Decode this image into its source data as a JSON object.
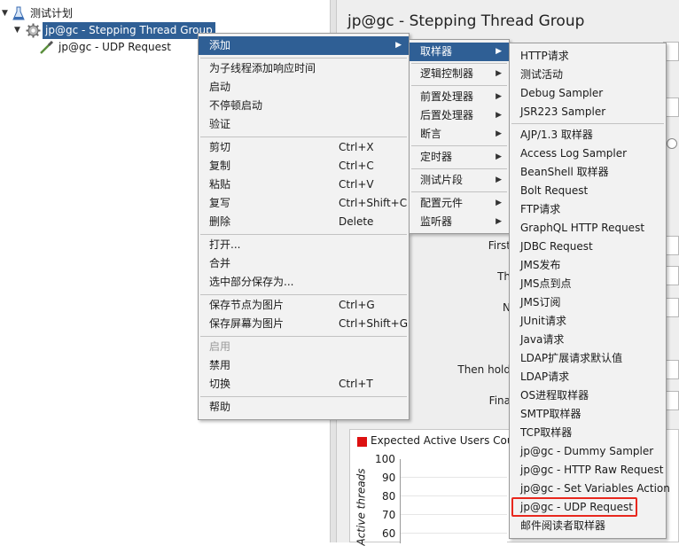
{
  "tree": {
    "root": "测试计划",
    "thread_group": "jp@gc - Stepping Thread Group",
    "child": "jp@gc - UDP Request"
  },
  "right_panel": {
    "title": "jp@gc - Stepping Thread Group",
    "field_labels": [
      "First",
      "Th",
      "N",
      "Then hold",
      "Fina"
    ]
  },
  "chart": {
    "legend": "Expected Active Users Count",
    "ylabel": "Active threads",
    "ticks": [
      "100",
      "90",
      "80",
      "70",
      "60"
    ],
    "legend_color": "#dd1111"
  },
  "context_menu": {
    "items": [
      {
        "label": "添加",
        "submenu": true
      },
      {
        "label": "为子线程添加响应时间"
      },
      {
        "label": "启动"
      },
      {
        "label": "不停顿启动"
      },
      {
        "label": "验证"
      },
      {
        "label": "剪切",
        "key": "Ctrl+X"
      },
      {
        "label": "复制",
        "key": "Ctrl+C"
      },
      {
        "label": "粘贴",
        "key": "Ctrl+V"
      },
      {
        "label": "复写",
        "key": "Ctrl+Shift+C"
      },
      {
        "label": "删除",
        "key": "Delete"
      },
      {
        "label": "打开..."
      },
      {
        "label": "合并"
      },
      {
        "label": "选中部分保存为..."
      },
      {
        "label": "保存节点为图片",
        "key": "Ctrl+G"
      },
      {
        "label": "保存屏幕为图片",
        "key": "Ctrl+Shift+G"
      },
      {
        "label": "启用"
      },
      {
        "label": "禁用"
      },
      {
        "label": "切换",
        "key": "Ctrl+T"
      },
      {
        "label": "帮助"
      }
    ]
  },
  "add_submenu": {
    "items": [
      "取样器",
      "逻辑控制器",
      "前置处理器",
      "后置处理器",
      "断言",
      "定时器",
      "测试片段",
      "配置元件",
      "监听器"
    ]
  },
  "sampler_submenu": {
    "items": [
      "HTTP请求",
      "测试活动",
      "Debug Sampler",
      "JSR223 Sampler",
      "AJP/1.3 取样器",
      "Access Log Sampler",
      "BeanShell 取样器",
      "Bolt Request",
      "FTP请求",
      "GraphQL HTTP Request",
      "JDBC Request",
      "JMS发布",
      "JMS点到点",
      "JMS订阅",
      "JUnit请求",
      "Java请求",
      "LDAP扩展请求默认值",
      "LDAP请求",
      "OS进程取样器",
      "SMTP取样器",
      "TCP取样器",
      "jp@gc - Dummy Sampler",
      "jp@gc - HTTP Raw Request",
      "jp@gc - Set Variables Action",
      "jp@gc - UDP Request",
      "邮件阅读者取样器"
    ]
  }
}
